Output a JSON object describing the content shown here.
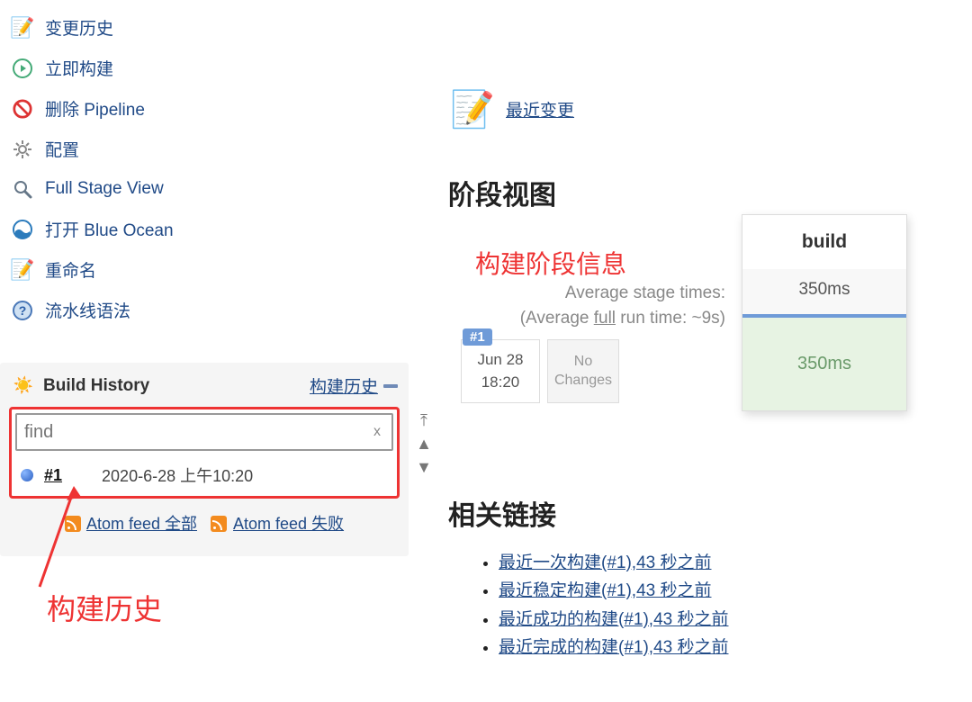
{
  "sidebar": {
    "items": [
      {
        "label": "变更历史"
      },
      {
        "label": "立即构建"
      },
      {
        "label": "删除 Pipeline"
      },
      {
        "label": "配置"
      },
      {
        "label": "Full Stage View"
      },
      {
        "label": "打开 Blue Ocean"
      },
      {
        "label": "重命名"
      },
      {
        "label": "流水线语法"
      }
    ]
  },
  "history": {
    "title": "Build History",
    "link_label": "构建历史",
    "find_placeholder": "find",
    "clear_label": "x",
    "build": {
      "number": "#1",
      "timestamp": "2020-6-28 上午10:20"
    },
    "feed_all": "Atom feed 全部",
    "feed_fail": "Atom feed 失败"
  },
  "annotation": {
    "history_label": "构建历史",
    "stage_label": "构建阶段信息"
  },
  "recent_changes_label": "最近变更",
  "stage": {
    "heading": "阶段视图",
    "avg_line1": "Average stage times:",
    "avg_line2_prefix": "(Average ",
    "avg_line2_full": "full",
    "avg_line2_suffix": " run time: ~9s)",
    "col_header": "build",
    "avg_value": "350ms",
    "run": {
      "badge": "#1",
      "date": "Jun 28",
      "time": "18:20",
      "changes": "No Changes",
      "duration": "350ms"
    }
  },
  "related": {
    "heading": "相关链接",
    "links": [
      "最近一次构建(#1),43 秒之前",
      "最近稳定构建(#1),43 秒之前",
      "最近成功的构建(#1),43 秒之前",
      "最近完成的构建(#1),43 秒之前"
    ]
  }
}
